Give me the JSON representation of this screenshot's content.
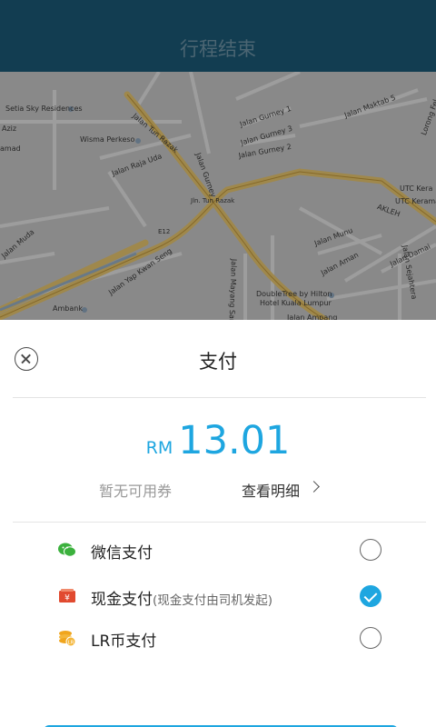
{
  "header": {
    "title": "行程结束"
  },
  "map": {
    "labels": [
      "Setia Sky Residences",
      "Aziz",
      "amad",
      "Wisma Perkeso",
      "Jalan Raja Uda",
      "Jalan Tun Razak",
      "Jalan Gurney",
      "Jalan Gurney 1",
      "Jalan Gurney 3",
      "Jalan Gurney 2",
      "Jalan Maktab 5",
      "UTC Kera",
      "UTC Kerama",
      "AKLEH",
      "Jln. Tun Razak",
      "E12",
      "Jalan Munu",
      "Jalan Aman",
      "Jalan Damai",
      "Jalan Sejahtera",
      "Jalan Yap Kwan Seng",
      "Ambank",
      "Jalan Mayang Sari",
      "DoubleTree by Hilton",
      "Hotel Kuala Lumpur",
      "Jalan Ampang",
      "Lorong Fel",
      "Jalan Muda"
    ]
  },
  "sheet": {
    "title": "支付",
    "price": {
      "currency": "RM",
      "amount": "13.01"
    },
    "coupon_text": "暂无可用券",
    "detail_text": "查看明细",
    "methods": [
      {
        "label": "微信支付",
        "note": "",
        "icon": "wechat-icon",
        "selected": false
      },
      {
        "label": "现金支付",
        "note": "(现金支付由司机发起)",
        "icon": "cash-icon",
        "selected": true
      },
      {
        "label": "LR币支付",
        "note": "",
        "icon": "lr-coin-icon",
        "selected": false
      }
    ]
  },
  "colors": {
    "accent": "#1ea6e0",
    "header": "#1b5a78",
    "wechat": "#3bb13d",
    "cash": "#e14a2f",
    "coin": "#f0a51d"
  }
}
